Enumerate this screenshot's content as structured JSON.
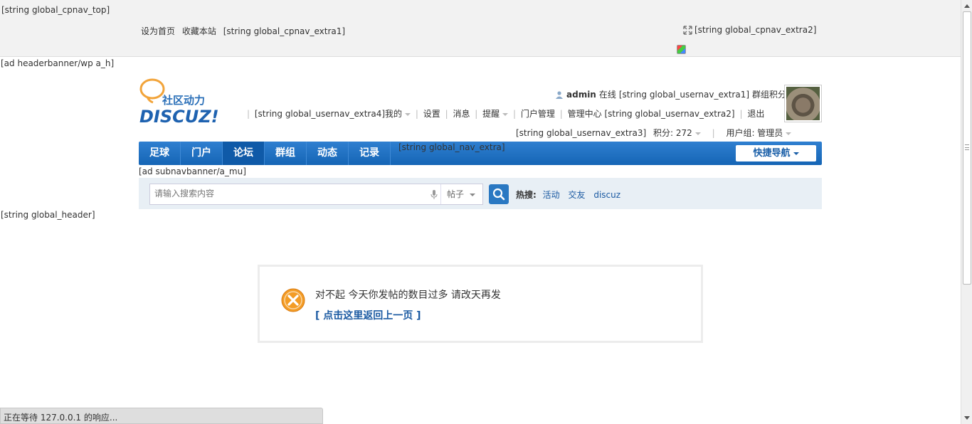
{
  "topbar": {
    "label": "[string global_cpnav_top]",
    "links": [
      "设为首页",
      "收藏本站"
    ],
    "extra1": "[string global_cpnav_extra1]",
    "extra2": "[string global_cpnav_extra2]"
  },
  "headerbanner": "[ad headerbanner/wp a_h]",
  "logo": {
    "text_cn": "社区动力",
    "text_en": "DISCUZ!"
  },
  "user": {
    "username": "admin",
    "online": "在线",
    "usernav_extra1": "[string global_usernav_extra1]",
    "group_points": "群组积分",
    "line2": {
      "extra4_mine": "[string global_usernav_extra4]我的",
      "settings": "设置",
      "messages": "消息",
      "reminders": "提醒",
      "portal_admin": "门户管理",
      "admin_center": "管理中心",
      "extra2": "[string global_usernav_extra2]",
      "logout": "退出"
    },
    "line3": {
      "extra3": "[string global_usernav_extra3]",
      "points": "积分: 272",
      "usergroup": "用户组: 管理员"
    }
  },
  "nav": {
    "items": [
      "足球",
      "门户",
      "论坛",
      "群组",
      "动态",
      "记录"
    ],
    "active_index": 2,
    "extra": "[string global_nav_extra]",
    "quicknav": "快捷导航"
  },
  "subnavbanner": "[ad subnavbanner/a_mu]",
  "search": {
    "placeholder": "请输入搜索内容",
    "type": "帖子",
    "hot_label": "热搜:",
    "hot_links": [
      "活动",
      "交友",
      "discuz"
    ]
  },
  "global_header": "[string global_header]",
  "message": {
    "text": "对不起 今天你发帖的数目过多 请改天再发",
    "back_link": "[ 点击这里返回上一页 ]"
  },
  "status_bar": "正在等待 127.0.0.1 的响应...",
  "colors": {
    "nav_blue": "#1a6fc0",
    "link_blue": "#1b5aa2",
    "error_orange": "#f39c25"
  }
}
